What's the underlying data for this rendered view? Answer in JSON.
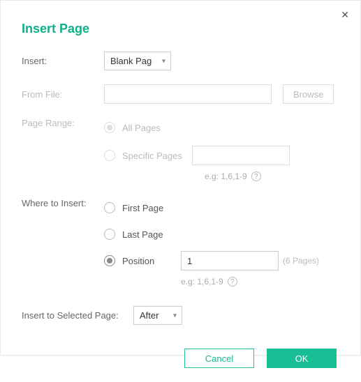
{
  "title": "Insert Page",
  "close_glyph": "✕",
  "fields": {
    "insert": {
      "label": "Insert:",
      "value": "Blank Page"
    },
    "from_file": {
      "label": "From File:",
      "value": "",
      "browse": "Browse"
    },
    "page_range": {
      "label": "Page Range:",
      "options": {
        "all": "All Pages",
        "specific": "Specific Pages"
      },
      "selected": "all",
      "specific_value": "",
      "hint": "e.g: 1,6,1-9"
    },
    "where": {
      "label": "Where to Insert:",
      "options": {
        "first": "First Page",
        "last": "Last Page",
        "position": "Position"
      },
      "selected": "position",
      "position_value": "1",
      "page_count_text": "(6 Pages)",
      "hint": "e.g: 1,6,1-9"
    },
    "insert_to_selected": {
      "label": "Insert to Selected Page:",
      "value": "After"
    }
  },
  "footer": {
    "cancel": "Cancel",
    "ok": "OK"
  },
  "glyphs": {
    "help": "?"
  }
}
